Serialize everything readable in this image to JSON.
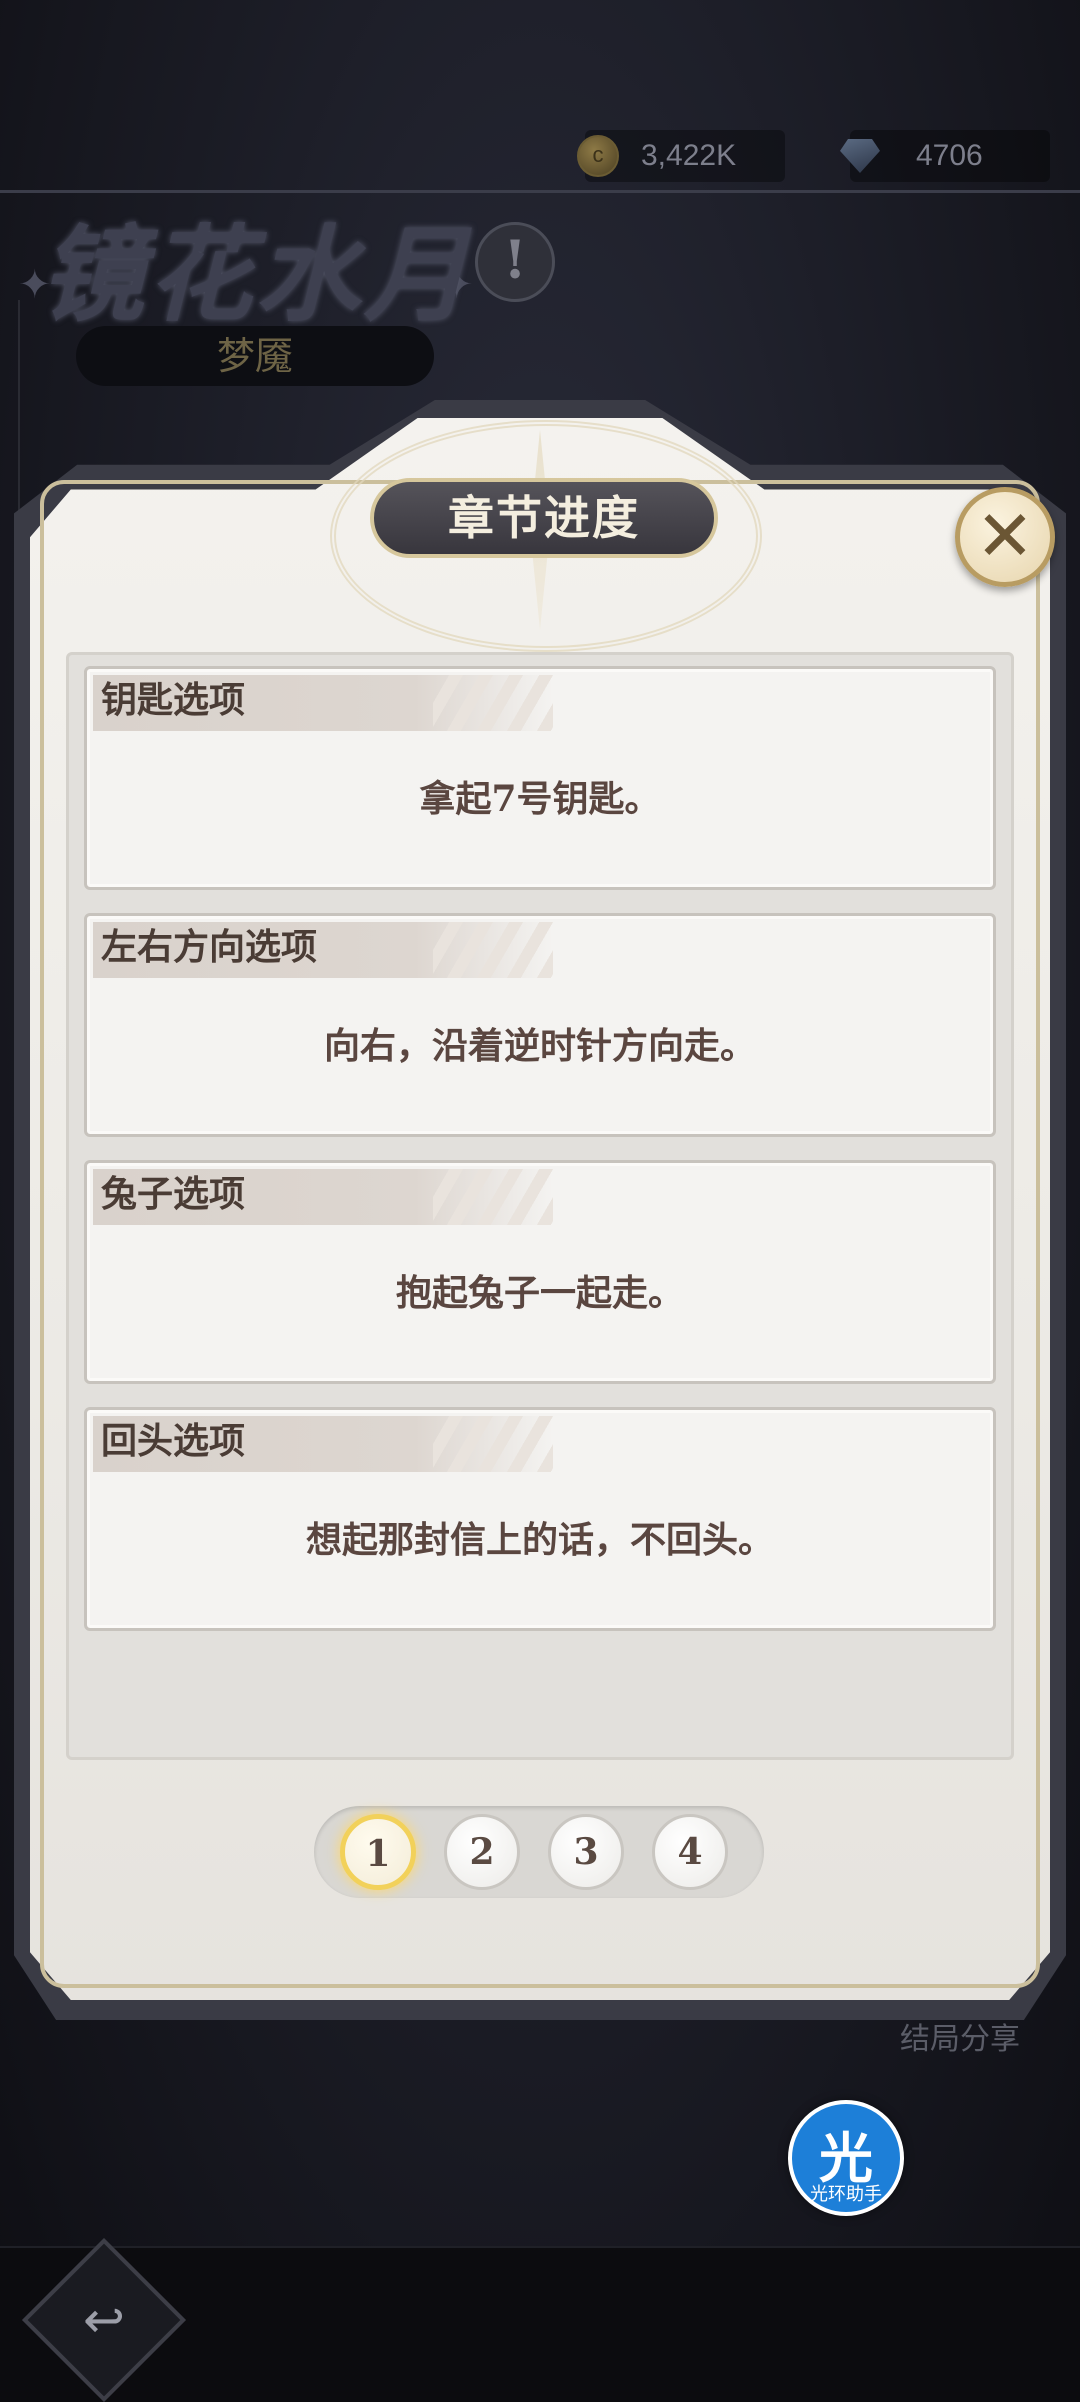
{
  "resources": {
    "coins": "3,422K",
    "gems": "4706",
    "coin_icon": "coin-icon",
    "gem_icon": "diamond-icon"
  },
  "chapter": {
    "title": "镜花水月",
    "subtitle": "梦魇"
  },
  "modal": {
    "title": "章节进度",
    "close_icon": "close-icon",
    "cards": [
      {
        "title": "钥匙选项",
        "text": "拿起7号钥匙。"
      },
      {
        "title": "左右方向选项",
        "text": "向右，沿着逆时针方向走。"
      },
      {
        "title": "兔子选项",
        "text": "抱起兔子一起走。"
      },
      {
        "title": "回头选项",
        "text": "想起那封信上的话，不回头。"
      }
    ],
    "pages": [
      "1",
      "2",
      "3",
      "4"
    ],
    "current_page": 1
  },
  "share_label": "结局分享",
  "assistant": {
    "glyph": "光",
    "label": "光环助手"
  },
  "colors": {
    "accent_gold": "#d6c79c",
    "active_page_ring": "#f2d15a",
    "assistant_blue": "#1d7fd8"
  }
}
